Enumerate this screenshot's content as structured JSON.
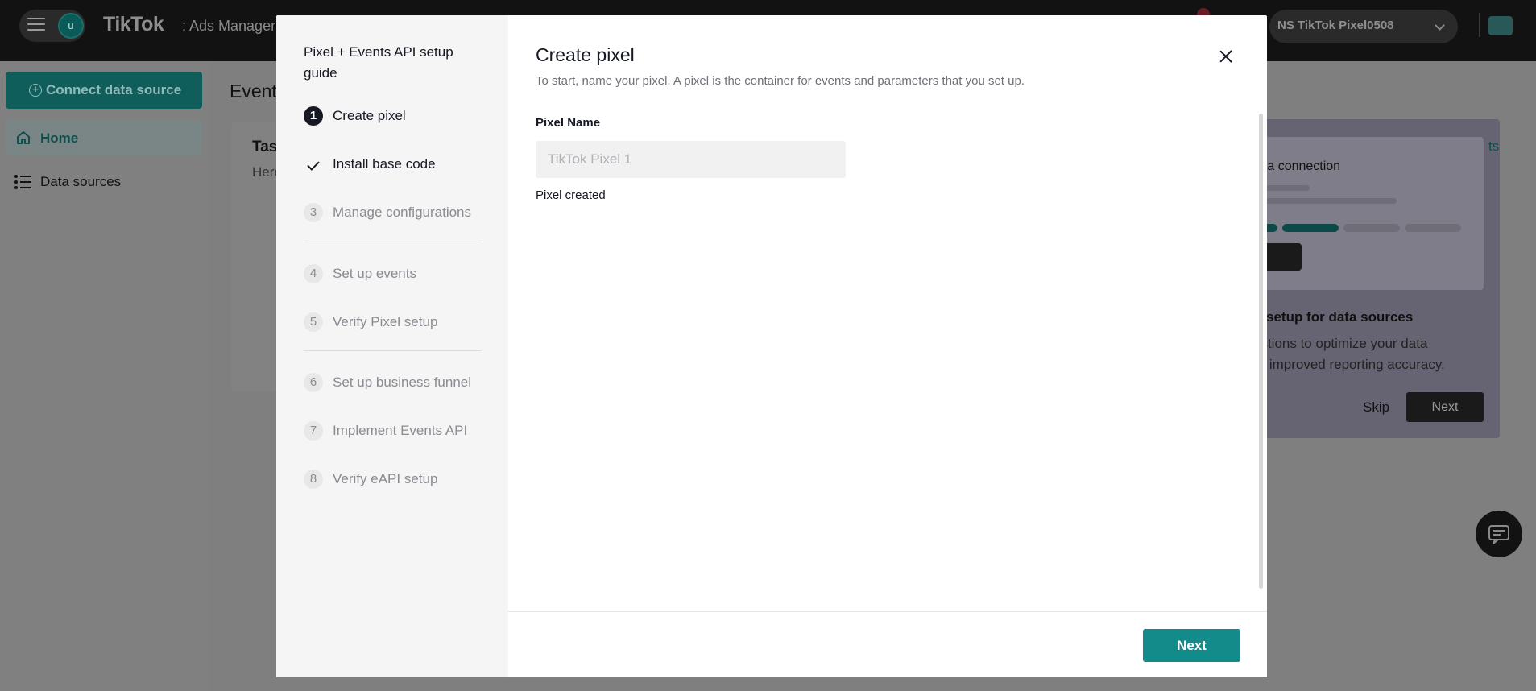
{
  "app": {
    "brand": "TikTok",
    "product": ": Ads Manager",
    "user_initial": "u"
  },
  "header": {
    "account_name": "NS TikTok Pixel0508"
  },
  "sidebar": {
    "connect_label": "Connect data source",
    "items": [
      {
        "label": "Home",
        "active": true
      },
      {
        "label": "Data sources",
        "active": false
      }
    ]
  },
  "page": {
    "title_partial": "Event",
    "card_title_partial": "Tas",
    "card_subtitle_partial": "Here"
  },
  "tour": {
    "illustration_caption": "ata connection",
    "heading": "setup for data sources",
    "body": "estions to optimize your data\nor improved reporting accuracy.",
    "skip_label": "Skip",
    "next_label": "Next",
    "edge_link": "ts"
  },
  "modal": {
    "guide_title": "Pixel + Events API setup guide",
    "steps": [
      {
        "num": "1",
        "label": "Create pixel",
        "state": "active"
      },
      {
        "num": "",
        "label": "Install base code",
        "state": "done"
      },
      {
        "num": "3",
        "label": "Manage configurations",
        "state": "pending"
      },
      {
        "num": "4",
        "label": "Set up events",
        "state": "pending"
      },
      {
        "num": "5",
        "label": "Verify Pixel setup",
        "state": "pending"
      },
      {
        "num": "6",
        "label": "Set up business funnel",
        "state": "pending"
      },
      {
        "num": "7",
        "label": "Implement Events API",
        "state": "pending"
      },
      {
        "num": "8",
        "label": "Verify eAPI setup",
        "state": "pending"
      }
    ],
    "title": "Create pixel",
    "description": "To start, name your pixel. A pixel is the container for events and parameters that you set up.",
    "field_label": "Pixel Name",
    "field_value": "",
    "field_placeholder": "TikTok Pixel 1",
    "field_hint": "Pixel created",
    "next_label": "Next"
  },
  "colors": {
    "accent": "#138B8A",
    "overlay": "#7F7F7F",
    "active_step": "#161823"
  },
  "icons": [
    "hamburger-icon",
    "home-icon",
    "list-icon",
    "plus-circle-icon",
    "chevron-down-icon",
    "close-icon",
    "check-icon",
    "chat-icon",
    "toolbox-icon"
  ]
}
